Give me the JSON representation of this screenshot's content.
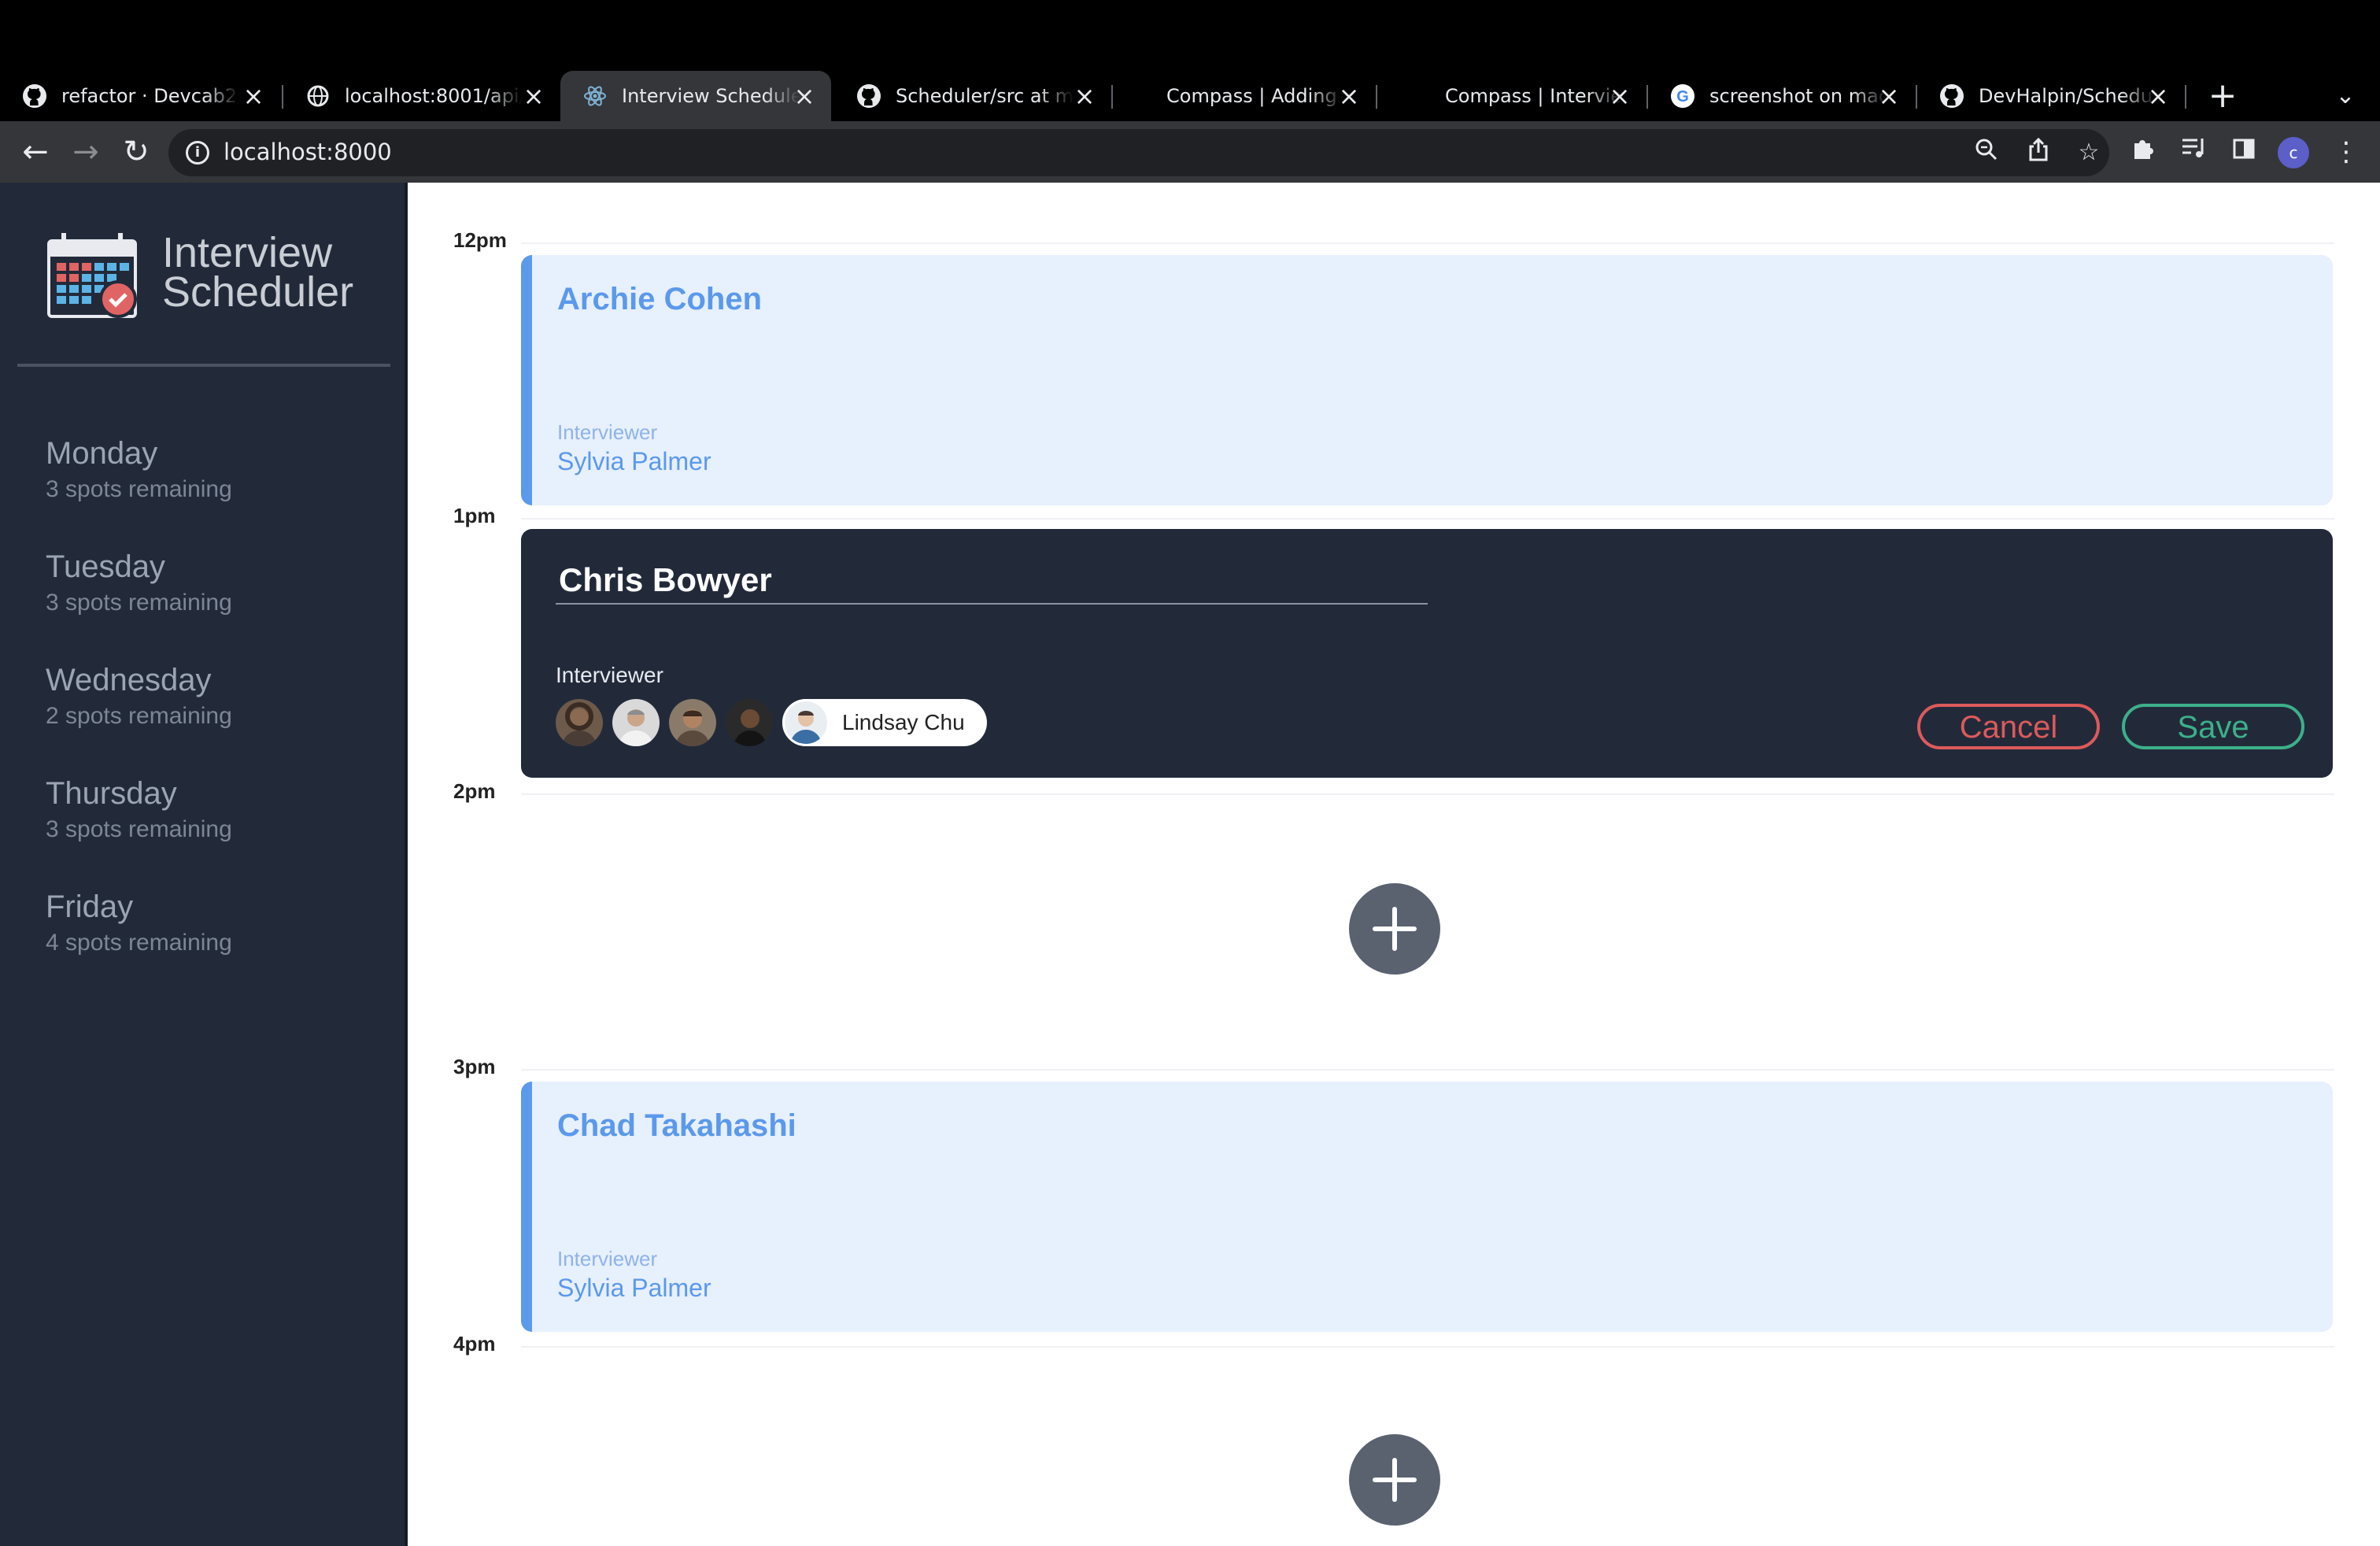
{
  "browser": {
    "tabs": [
      {
        "title": "refactor · Devcab2/",
        "icon": "github-icon"
      },
      {
        "title": "localhost:8001/api/",
        "icon": "globe-icon"
      },
      {
        "title": "Interview Schedule",
        "icon": "react-icon",
        "active": true
      },
      {
        "title": "Scheduler/src at m",
        "icon": "github-icon"
      },
      {
        "title": "Compass | Adding",
        "icon": "none"
      },
      {
        "title": "Compass | Intervie",
        "icon": "none"
      },
      {
        "title": "screenshot on mac",
        "icon": "google-icon"
      },
      {
        "title": "DevHalpin/Schedul",
        "icon": "github-icon"
      }
    ],
    "url": "localhost:8000",
    "profile_initial": "c"
  },
  "sidebar": {
    "logo_line1": "Interview",
    "logo_line2": "Scheduler",
    "days": [
      {
        "name": "Monday",
        "spots": "3 spots remaining"
      },
      {
        "name": "Tuesday",
        "spots": "3 spots remaining"
      },
      {
        "name": "Wednesday",
        "spots": "2 spots remaining"
      },
      {
        "name": "Thursday",
        "spots": "3 spots remaining"
      },
      {
        "name": "Friday",
        "spots": "4 spots remaining"
      }
    ]
  },
  "schedule": {
    "times": [
      "12pm",
      "1pm",
      "2pm",
      "3pm",
      "4pm"
    ],
    "appointments": [
      {
        "student": "Archie Cohen",
        "interviewer_label": "Interviewer",
        "interviewer": "Sylvia Palmer"
      },
      {
        "student": "Chad Takahashi",
        "interviewer_label": "Interviewer",
        "interviewer": "Sylvia Palmer"
      }
    ],
    "form": {
      "student_value": "Chris Bowyer",
      "interviewer_label": "Interviewer",
      "selected_interviewer": "Lindsay Chu",
      "cancel_label": "Cancel",
      "save_label": "Save"
    }
  },
  "colors": {
    "sidebar_bg": "#222a3a",
    "accent_blue": "#5b99ec",
    "appt_bg": "#e7f0fd",
    "cancel_red": "#dd5a5a",
    "save_green": "#3cb08a",
    "add_button": "#5a6270"
  }
}
